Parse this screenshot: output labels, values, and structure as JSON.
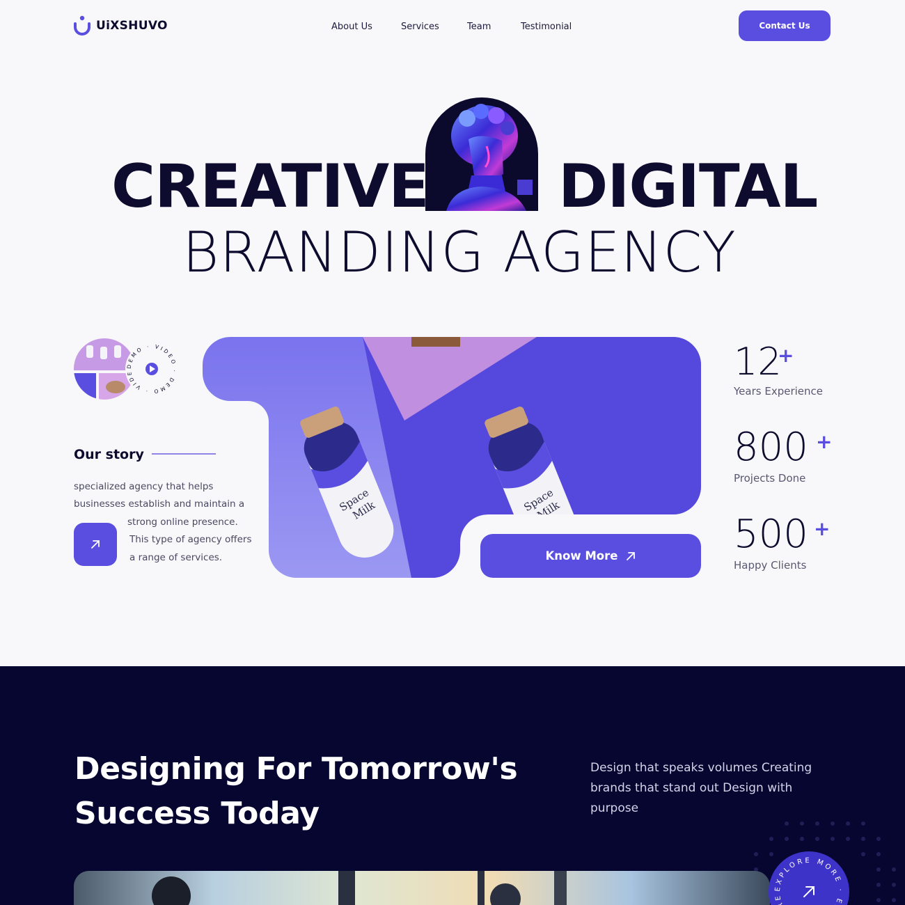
{
  "brand": {
    "name": "UiXSHUVO",
    "accent": "#5a4ee0",
    "dark": "#060631"
  },
  "nav": {
    "links": [
      "About Us",
      "Services",
      "Team",
      "Testimonial"
    ],
    "contact_label": "Contact Us"
  },
  "hero": {
    "word1": "CREATIVE",
    "word2": "DIGITAL",
    "line2": "BRANDING AGENCY"
  },
  "demo_badge": {
    "text": "DEMO · VIDEO · DEMO · VIDEO ·",
    "icon": "play-icon"
  },
  "story": {
    "title": "Our story",
    "lines": [
      "specialized agency that helps",
      "businesses establish and maintain a",
      "strong online presence.",
      "This type of agency offers",
      "a range of services."
    ],
    "arrow_icon": "arrow-up-right-icon"
  },
  "product": {
    "label_top": "Space",
    "label_bottom": "Milk",
    "cta_label": "Know More"
  },
  "stats": [
    {
      "value": "12",
      "suffix": "+",
      "label": "Years Experience"
    },
    {
      "value": "800",
      "suffix": "+",
      "label": "Projects Done"
    },
    {
      "value": "500",
      "suffix": "+",
      "label": "Happy Clients"
    }
  ],
  "section2": {
    "title_line1": "Designing For Tomorrow's",
    "title_line2": "Success Today",
    "desc_lines": [
      "Design that speaks volumes Creating",
      "brands that stand out Design with",
      "purpose"
    ],
    "explore_text": "EXPLORE MORE · EXPLORE MORE ·"
  }
}
